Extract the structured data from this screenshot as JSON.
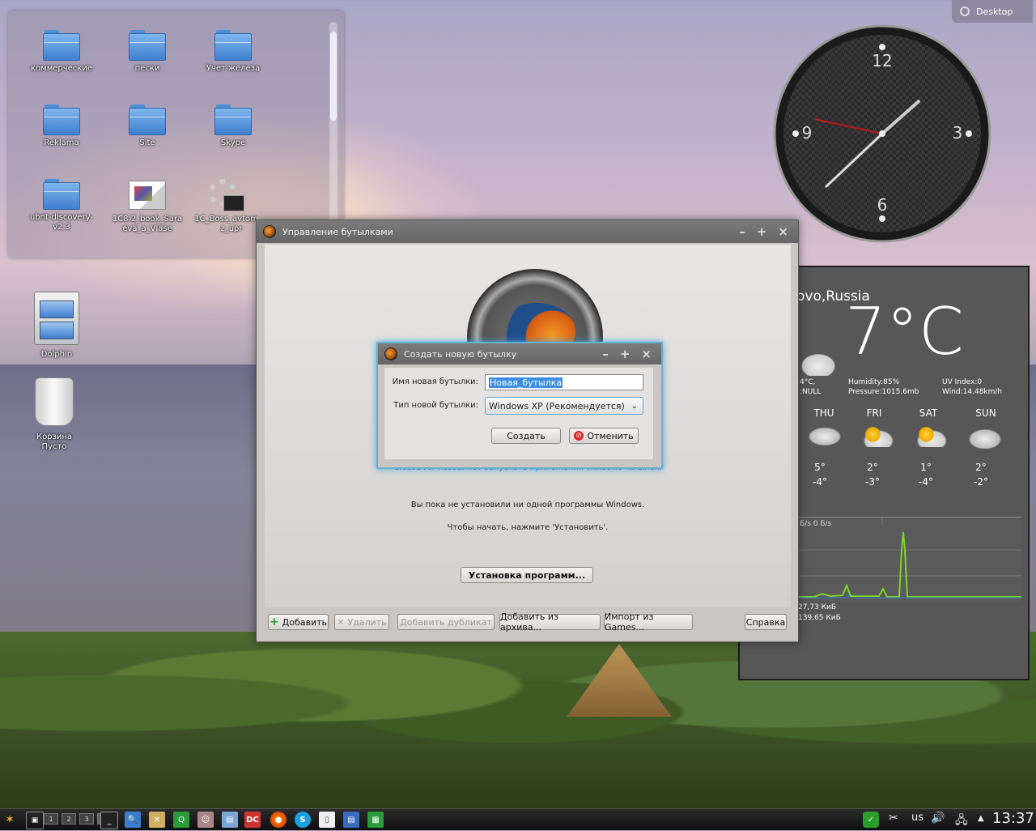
{
  "desktop_button": {
    "label": "Desktop"
  },
  "folderview": {
    "items": [
      {
        "label": "коммерческие",
        "type": "folder"
      },
      {
        "label": "пески",
        "type": "folder"
      },
      {
        "label": "Учет железа",
        "type": "folder"
      },
      {
        "label": "Reklama",
        "type": "folder"
      },
      {
        "label": "Site",
        "type": "folder"
      },
      {
        "label": "Skype",
        "type": "folder"
      },
      {
        "label": "ubnt-discovery-v2.3",
        "type": "folder"
      },
      {
        "label": "1C8.2_book_Saraeva_a_Vlase",
        "type": "file"
      },
      {
        "label": "1C_Boss_avtomatiz_upr",
        "type": "executable"
      }
    ]
  },
  "desktop_icons": {
    "dolphin": "Dolphin",
    "trash_line1": "Корзина",
    "trash_line2": "Пусто"
  },
  "clock": {
    "hour": 1,
    "minute": 37,
    "second": 47
  },
  "weather": {
    "city": "ovo,Russia",
    "temp": "7°C",
    "left1": "4°C,",
    "left2": ":NULL",
    "humidity": "Humidity:85%",
    "pressure": "Pressure:1015.6mb",
    "uv": "UV Index:0",
    "wind": "Wind:14.48km/h",
    "days": [
      {
        "name": "THU",
        "hi": "5°",
        "lo": "-4°",
        "icon": "snow-cloud-icon"
      },
      {
        "name": "FRI",
        "hi": "2°",
        "lo": "-3°",
        "icon": "sun-cloud-icon"
      },
      {
        "name": "SAT",
        "hi": "1°",
        "lo": "-4°",
        "icon": "sun-cloud-icon"
      },
      {
        "name": "SUN",
        "hi": "2°",
        "lo": "-2°",
        "icon": "cloud-icon"
      }
    ],
    "net_rate": "Б/s 0 Б/s",
    "net_rx": "27,73 КиБ",
    "net_tx": "139,65 КиБ"
  },
  "main_window": {
    "title": "Управление бутылками",
    "description": "CrossOver позволяет запускать приложения Windows на Linux.",
    "no_programs": "Вы пока не установили ни одной программы Windows.",
    "hint": "Чтобы начать, нажмите 'Установить'.",
    "install_button": "Установка программ...",
    "buttons": {
      "add": "Добавить",
      "delete": "Удалить",
      "duplicate": "Добавить дубликат",
      "from_archive": "Добавить из архива...",
      "import": "Импорт из Games...",
      "help": "Справка"
    }
  },
  "dialog": {
    "title": "Создать новую бутылку",
    "name_label": "Имя новая бутылки:",
    "name_value": "Новая_бутылка",
    "type_label": "Тип новой бутылки:",
    "type_value": "Windows XP (Рекомендуется)",
    "create_button": "Создать",
    "cancel_button": "Отменить"
  },
  "taskbar": {
    "pager": [
      "1",
      "2",
      "3",
      "4"
    ],
    "keyboard_layout": "us",
    "time": "13:37"
  },
  "colors": {
    "accent_blue": "#5fa3d3",
    "graph_green": "#7cd42a",
    "weather_bg": "#575757"
  }
}
